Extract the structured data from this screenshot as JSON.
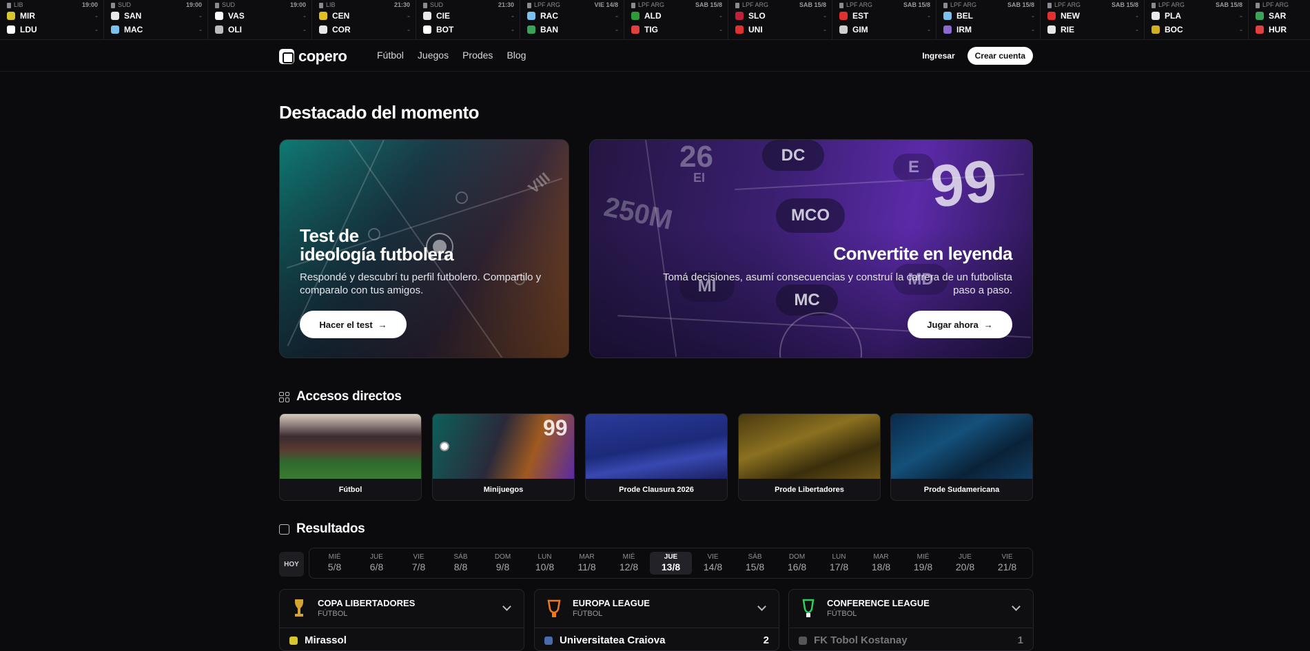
{
  "ticker": [
    {
      "league": "LIB",
      "time": "19:00",
      "home": "MIR",
      "away": "LDU",
      "home_score": "-",
      "away_score": "-",
      "home_color": "#d8c630",
      "away_color": "#ffffff"
    },
    {
      "league": "SUD",
      "time": "19:00",
      "home": "SAN",
      "away": "MAC",
      "home_score": "-",
      "away_score": "-",
      "home_color": "#e8e8e8",
      "away_color": "#7cc0ee"
    },
    {
      "league": "SUD",
      "time": "19:00",
      "home": "VAS",
      "away": "OLI",
      "home_score": "-",
      "away_score": "-",
      "home_color": "#ffffff",
      "away_color": "#bdbdbd"
    },
    {
      "league": "LIB",
      "time": "21:30",
      "home": "CEN",
      "away": "COR",
      "home_score": "-",
      "away_score": "-",
      "home_color": "#e0c020",
      "away_color": "#e8e8e8"
    },
    {
      "league": "SUD",
      "time": "21:30",
      "home": "CIE",
      "away": "BOT",
      "home_score": "-",
      "away_score": "-",
      "home_color": "#e8e8e8",
      "away_color": "#ffffff"
    },
    {
      "league": "LPF ARG",
      "time": "VIE 14/8",
      "home": "RAC",
      "away": "BAN",
      "home_score": "-",
      "away_score": "-",
      "home_color": "#7cc0ee",
      "away_color": "#3aa35a"
    },
    {
      "league": "LPF ARG",
      "time": "SAB 15/8",
      "home": "ALD",
      "away": "TIG",
      "home_score": "-",
      "away_score": "-",
      "home_color": "#2f9a3a",
      "away_color": "#e04040"
    },
    {
      "league": "LPF ARG",
      "time": "SAB 15/8",
      "home": "SLO",
      "away": "UNI",
      "home_score": "-",
      "away_score": "-",
      "home_color": "#c0203a",
      "away_color": "#e03030"
    },
    {
      "league": "LPF ARG",
      "time": "SAB 15/8",
      "home": "EST",
      "away": "GIM",
      "home_score": "-",
      "away_score": "-",
      "home_color": "#e03030",
      "away_color": "#d0d0d0"
    },
    {
      "league": "LPF ARG",
      "time": "SAB 15/8",
      "home": "BEL",
      "away": "IRM",
      "home_score": "-",
      "away_score": "-",
      "home_color": "#7cc0ee",
      "away_color": "#8a6ad0"
    },
    {
      "league": "LPF ARG",
      "time": "SAB 15/8",
      "home": "NEW",
      "away": "RIE",
      "home_score": "-",
      "away_score": "-",
      "home_color": "#e03030",
      "away_color": "#e8e8e8"
    },
    {
      "league": "LPF ARG",
      "time": "SAB 15/8",
      "home": "PLA",
      "away": "BOC",
      "home_score": "-",
      "away_score": "-",
      "home_color": "#e8e8e8",
      "away_color": "#d0b020"
    },
    {
      "league": "LPF ARG",
      "time": "",
      "home": "SAR",
      "away": "HUR",
      "home_score": "",
      "away_score": "",
      "home_color": "#3aa35a",
      "away_color": "#e04040"
    }
  ],
  "nav": {
    "logo": "copero",
    "links": [
      "Fútbol",
      "Juegos",
      "Prodes",
      "Blog"
    ],
    "login": "Ingresar",
    "signup": "Crear cuenta"
  },
  "featured": {
    "title": "Destacado del momento",
    "card1": {
      "title_line1": "Test de",
      "title_line2": "ideología futbolera",
      "desc": "Respondé y descubrí tu perfil futbolero. Compartilo y comparalo con tus amigos.",
      "button": "Hacer el test"
    },
    "card2": {
      "title": "Convertite en leyenda",
      "desc": "Tomá decisiones, asumí consecuencias y construí la carrera de un futbolista paso a paso.",
      "button": "Jugar ahora"
    }
  },
  "accesses": {
    "title": "Accesos directos",
    "items": [
      "Fútbol",
      "Minijuegos",
      "Prode Clausura 2026",
      "Prode Libertadores",
      "Prode Sudamericana"
    ]
  },
  "results": {
    "title": "Resultados",
    "today": "HOY",
    "days": [
      {
        "name": "MIÉ",
        "date": "5/8"
      },
      {
        "name": "JUE",
        "date": "6/8"
      },
      {
        "name": "VIE",
        "date": "7/8"
      },
      {
        "name": "SÁB",
        "date": "8/8"
      },
      {
        "name": "DOM",
        "date": "9/8"
      },
      {
        "name": "LUN",
        "date": "10/8"
      },
      {
        "name": "MAR",
        "date": "11/8"
      },
      {
        "name": "MIÉ",
        "date": "12/8"
      },
      {
        "name": "JUE",
        "date": "13/8"
      },
      {
        "name": "VIE",
        "date": "14/8"
      },
      {
        "name": "SÁB",
        "date": "15/8"
      },
      {
        "name": "DOM",
        "date": "16/8"
      },
      {
        "name": "LUN",
        "date": "17/8"
      },
      {
        "name": "MAR",
        "date": "18/8"
      },
      {
        "name": "MIÉ",
        "date": "19/8"
      },
      {
        "name": "JUE",
        "date": "20/8"
      },
      {
        "name": "VIE",
        "date": "21/8"
      }
    ],
    "selected_day": 8,
    "competitions": [
      {
        "name": "COPA LIBERTADORES",
        "sport": "FÚTBOL",
        "first_team": "Mirassol",
        "first_score": ""
      },
      {
        "name": "EUROPA LEAGUE",
        "sport": "FÚTBOL",
        "first_team": "Universitatea Craiova",
        "first_score": "2"
      },
      {
        "name": "CONFERENCE LEAGUE",
        "sport": "FÚTBOL",
        "first_team": "FK Tobol Kostanay",
        "first_score": "1"
      }
    ]
  }
}
